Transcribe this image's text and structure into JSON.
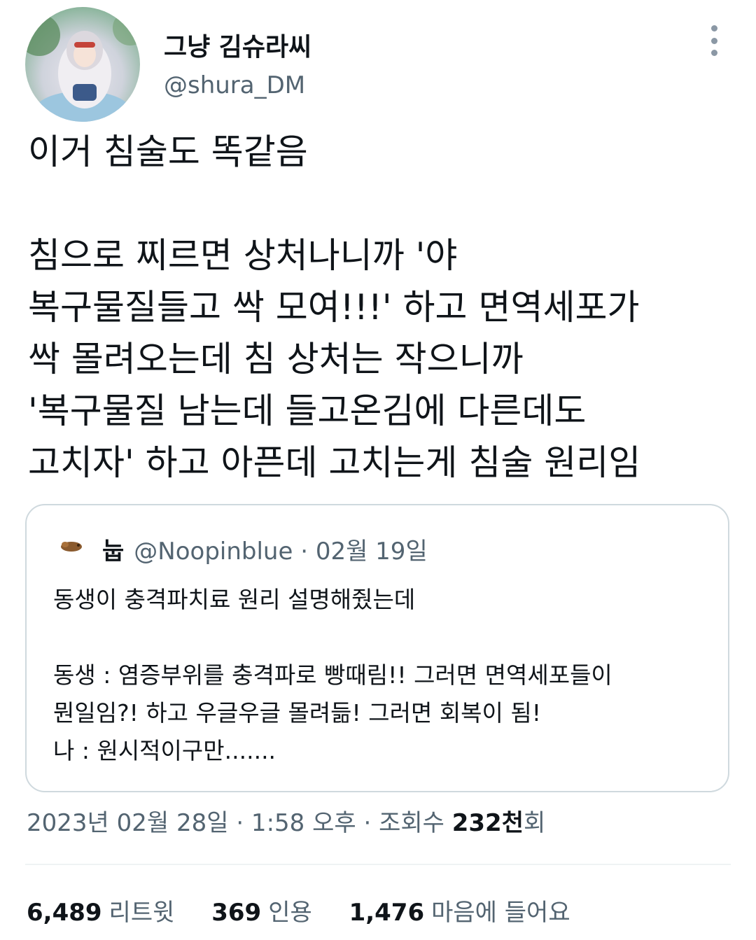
{
  "author": {
    "display_name": "그냥 김슈라씨",
    "handle": "@shura_DM"
  },
  "tweet": {
    "text": "이거 침술도 똑같음\n\n침으로 찌르면 상처나니까 '야\n복구물질들고 싹 모여!!!' 하고 면역세포가\n싹 몰려오는데 침 상처는 작으니까\n'복구물질 남는데 들고온김에 다른데도\n고치자' 하고 아픈데 고치는게 침술 원리임"
  },
  "quote": {
    "name": "눕",
    "handle": "@Noopinblue",
    "separator": "·",
    "date": "02월 19일",
    "text": "동생이 충격파치료 원리 설명해줬는데\n\n동생 : 염증부위를 충격파로 빵때림!! 그러면 면역세포들이\n뭔일임?! 하고 우글우글 몰려듦! 그러면 회복이 됨!\n나 : 원시적이구만......."
  },
  "meta": {
    "datetime": "2023년 02월 28일 · 1:58 오후 · 조회수 ",
    "views_number": "232천",
    "views_suffix": "회"
  },
  "stats": {
    "retweets": {
      "count": "6,489",
      "label": "리트윗"
    },
    "quotes": {
      "count": "369",
      "label": "인용"
    },
    "likes": {
      "count": "1,476",
      "label": "마음에 들어요"
    }
  },
  "icons": {
    "more": "more-vertical-icon"
  }
}
